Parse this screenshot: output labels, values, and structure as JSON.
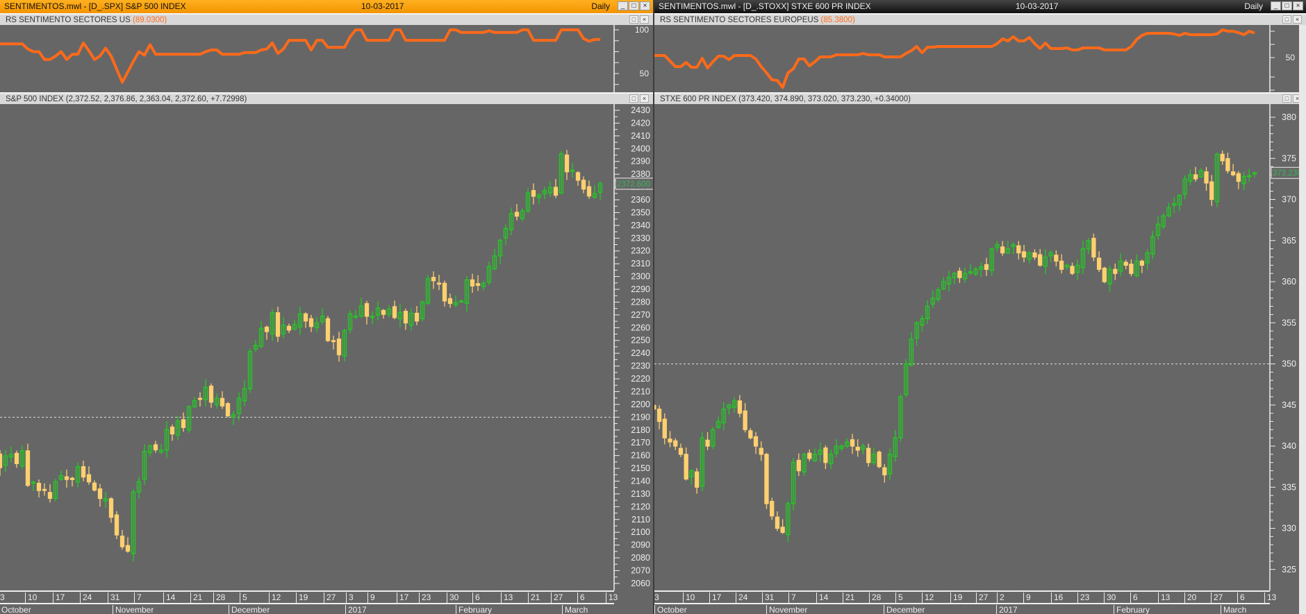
{
  "colors": {
    "up": "#22cc22",
    "down": "#ffd070",
    "indicator": "#ff6a1a",
    "background": "#666666",
    "title_left": "#f7a000",
    "title_right": "#222222"
  },
  "left": {
    "window_title": "SENTIMENTOS.mwl - [D_.SPX] S&P 500 INDEX",
    "date": "10-03-2017",
    "period": "Daily",
    "indicator": {
      "name": "RS SENTIMENTO SECTORES US",
      "value": "(89.0300)",
      "axis_labels": [
        "100",
        "50"
      ],
      "values": [
        84,
        84,
        84,
        84,
        84,
        78,
        75,
        75,
        66,
        66,
        70,
        75,
        66,
        72,
        72,
        85,
        76,
        66,
        70,
        79,
        70,
        55,
        40,
        52,
        64,
        75,
        71,
        83,
        72,
        72,
        72,
        72,
        72,
        72,
        72,
        72,
        72,
        75,
        77,
        77,
        72,
        72,
        72,
        72,
        74,
        74,
        74,
        77,
        78,
        85,
        73,
        78,
        88,
        88,
        88,
        88,
        77,
        88,
        88,
        80,
        80,
        80,
        80,
        92,
        100,
        100,
        88,
        88,
        88,
        88,
        88,
        100,
        100,
        88,
        88,
        88,
        88,
        88,
        88,
        88,
        88,
        100,
        100,
        97,
        97,
        97,
        97,
        97,
        99,
        97,
        97,
        97,
        97,
        97,
        100,
        100,
        88,
        88,
        88,
        88,
        88,
        100,
        100,
        100,
        100,
        90,
        87,
        89,
        89.03
      ]
    },
    "price": {
      "name": "S&P 500 INDEX",
      "ohlc_text": "(2,372.52, 2,376.86, 2,363.04, 2,372.60, +7.72998)",
      "last_label": "2372.600",
      "reference_line": 2190,
      "axis_min": 2060,
      "axis_max": 2430,
      "axis_step": 10,
      "closes": [
        2161.2,
        2150.5,
        2159.7,
        2160.8,
        2153.7,
        2163.7,
        2136.7,
        2139.2,
        2132.6,
        2133.0,
        2126.5,
        2139.6,
        2144.3,
        2141.3,
        2141.2,
        2151.3,
        2143.2,
        2139.4,
        2133.0,
        2126.4,
        2126.2,
        2111.7,
        2097.9,
        2088.7,
        2085.2,
        2131.5,
        2139.6,
        2163.3,
        2167.5,
        2164.5,
        2164.2,
        2180.4,
        2176.9,
        2187.1,
        2181.9,
        2198.2,
        2202.9,
        2204.7,
        2213.4,
        2201.7,
        2204.7,
        2198.8,
        2191.1,
        2191.9,
        2204.7,
        2212.2,
        2241.4,
        2246.2,
        2259.5,
        2256.9,
        2271.7,
        2253.3,
        2262.0,
        2258.1,
        2262.5,
        2270.8,
        2265.2,
        2260.9,
        2263.8,
        2268.9,
        2249.9,
        2249.3,
        2238.8,
        2257.8,
        2270.8,
        2269.0,
        2277.0,
        2268.9,
        2268.9,
        2275.3,
        2270.4,
        2274.6,
        2267.9,
        2271.9,
        2263.7,
        2271.3,
        2265.2,
        2280.1,
        2298.4,
        2296.7,
        2294.7,
        2280.9,
        2278.9,
        2279.6,
        2280.9,
        2297.4,
        2292.6,
        2293.1,
        2294.7,
        2307.9,
        2316.1,
        2328.3,
        2337.6,
        2349.3,
        2347.2,
        2351.2,
        2365.4,
        2362.8,
        2363.8,
        2367.3,
        2369.8,
        2363.6,
        2396.0,
        2381.9,
        2383.1,
        2375.3,
        2368.4,
        2363.0,
        2364.9,
        2372.6
      ]
    },
    "x_days": [
      "3",
      "10",
      "17",
      "24",
      "31",
      "7",
      "14",
      "21",
      "28",
      "5",
      "12",
      "19",
      "27",
      "3",
      "9",
      "17",
      "23",
      "30",
      "6",
      "13",
      "21",
      "27",
      "6",
      "13"
    ],
    "x_months": [
      "October",
      "November",
      "December",
      "2017",
      "February",
      "March"
    ]
  },
  "right": {
    "window_title": "SENTIMENTOS.mwl - [D_.STOXX] STXE 600 PR INDEX",
    "date": "10-03-2017",
    "period": "Daily",
    "indicator": {
      "name": "RS SENTIMENTO SECTORES EUROPEUS",
      "value": "(85.3800)",
      "axis_labels": [
        "50"
      ],
      "values": [
        53,
        53,
        53,
        45,
        37,
        37,
        43,
        36,
        36,
        49,
        35,
        44,
        52,
        52,
        47,
        53,
        53,
        53,
        53,
        48,
        37,
        28,
        18,
        17,
        7,
        28,
        34,
        48,
        48,
        38,
        44,
        51,
        51,
        51,
        54,
        54,
        54,
        54,
        54,
        56,
        54,
        54,
        54,
        51,
        51,
        51,
        51,
        56,
        60,
        66,
        57,
        65,
        65,
        66,
        66,
        66,
        66,
        66,
        66,
        66,
        66,
        66,
        66,
        66,
        70,
        77,
        74,
        80,
        74,
        74,
        79,
        70,
        63,
        71,
        63,
        63,
        63,
        64,
        61,
        61,
        64,
        64,
        64,
        64,
        61,
        61,
        61,
        61,
        61,
        66,
        76,
        82,
        85,
        85,
        85,
        85,
        85,
        84,
        82,
        85,
        83,
        83,
        83,
        83,
        83,
        84,
        90,
        88,
        88,
        86,
        83,
        88,
        85.38
      ]
    },
    "price": {
      "name": "STXE 600 PR INDEX",
      "ohlc_text": "(373.420, 374.890, 373.020, 373.230, +0.34000)",
      "last_label": "373.2300",
      "reference_line": 350,
      "axis_min": 325,
      "axis_max": 380,
      "axis_step": 5,
      "closes": [
        344.5,
        343,
        341,
        340.5,
        340,
        339,
        336,
        337,
        335,
        341,
        340,
        342,
        343,
        344.5,
        345,
        345.5,
        344,
        342,
        341,
        340,
        339,
        333,
        331.5,
        330,
        329.5,
        333,
        338,
        337,
        339,
        338.5,
        339,
        339.5,
        338,
        339,
        340,
        340,
        340.5,
        340,
        339.5,
        340,
        338,
        339,
        337.5,
        336.5,
        339,
        341,
        346,
        350,
        353,
        355,
        355.5,
        357,
        358,
        359,
        360,
        360.5,
        361,
        360.5,
        361,
        361.2,
        361.5,
        361.8,
        361.5,
        364,
        364.5,
        363.5,
        364,
        364.5,
        363.5,
        363,
        363.5,
        363,
        362,
        363,
        363.5,
        362.5,
        361.5,
        362,
        361,
        362,
        364,
        365,
        363,
        361.5,
        360,
        361.5,
        361,
        362.5,
        362,
        361,
        362.5,
        362,
        363.5,
        365.5,
        367,
        368,
        369,
        369.5,
        370.5,
        372.5,
        373,
        372.5,
        373.5,
        372,
        370,
        375.5,
        374.7,
        373.5,
        373,
        372.2,
        372.8,
        372.9,
        373.23
      ]
    },
    "x_days": [
      "3",
      "10",
      "17",
      "24",
      "31",
      "7",
      "14",
      "21",
      "28",
      "5",
      "12",
      "19",
      "27",
      "2",
      "9",
      "16",
      "23",
      "30",
      "6",
      "13",
      "20",
      "27",
      "6",
      "13"
    ],
    "x_months": [
      "October",
      "November",
      "December",
      "2017",
      "February",
      "March"
    ]
  }
}
